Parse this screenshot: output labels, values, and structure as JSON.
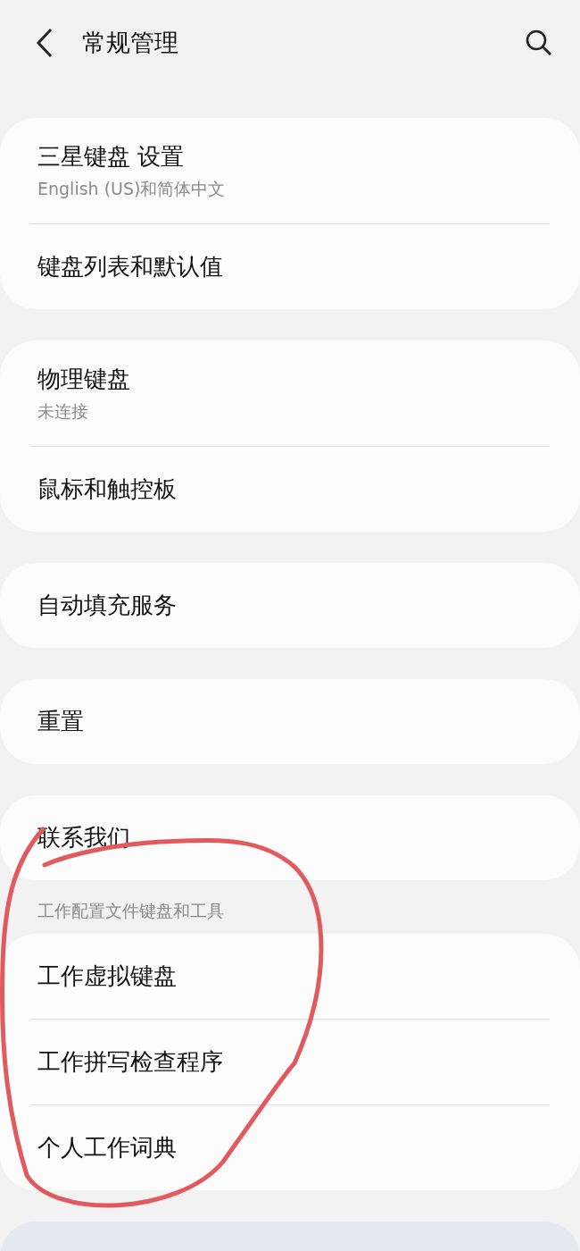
{
  "header": {
    "title": "常规管理"
  },
  "groups": [
    {
      "items": [
        {
          "title": "三星键盘 设置",
          "subtitle": "English (US)和简体中文"
        },
        {
          "title": "键盘列表和默认值"
        }
      ]
    },
    {
      "items": [
        {
          "title": "物理键盘",
          "subtitle": "未连接"
        },
        {
          "title": "鼠标和触控板"
        }
      ]
    },
    {
      "items": [
        {
          "title": "自动填充服务"
        }
      ]
    },
    {
      "items": [
        {
          "title": "重置"
        }
      ]
    },
    {
      "items": [
        {
          "title": "联系我们"
        }
      ]
    },
    {
      "heading": "工作配置文件键盘和工具",
      "items": [
        {
          "title": "工作虚拟键盘"
        },
        {
          "title": "工作拼写检查程序"
        },
        {
          "title": "个人工作词典"
        }
      ]
    }
  ]
}
